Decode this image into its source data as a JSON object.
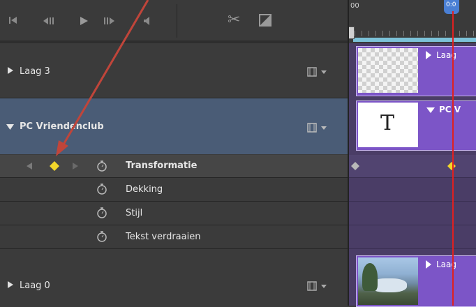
{
  "transport": {
    "go_start_icon": "⏮",
    "step_back_icon": "◂",
    "play_icon": "▶",
    "step_forward_icon": "▸",
    "volume_icon": "◀",
    "scissors_icon": "✂",
    "split_icon": "◪"
  },
  "ruler": {
    "start_label": "00",
    "playhead_label": "0:0"
  },
  "tracks": [
    {
      "id": "laag3",
      "label": "Laag 3",
      "clip_label": "Laag",
      "expanded": false
    },
    {
      "id": "pc",
      "label": "PC Vriendenclub",
      "clip_label": "PC V",
      "expanded": true
    },
    {
      "id": "laag0",
      "label": "Laag 0",
      "clip_label": "Laag",
      "expanded": false
    }
  ],
  "properties": [
    {
      "label": "Transformatie",
      "bold": true,
      "keyframed": true
    },
    {
      "label": "Dekking",
      "bold": false
    },
    {
      "label": "Stijl",
      "bold": false
    },
    {
      "label": "Tekst verdraaien",
      "bold": false
    }
  ],
  "text_clip_glyph": "T",
  "colors": {
    "panel_bg": "#3b3b3b",
    "selected_track_bg": "#4a5c76",
    "clip_purple": "#7c55c7",
    "playhead": "#e02020",
    "keyframe": "#f2d62a",
    "annotation_arrow": "#c0453a"
  }
}
